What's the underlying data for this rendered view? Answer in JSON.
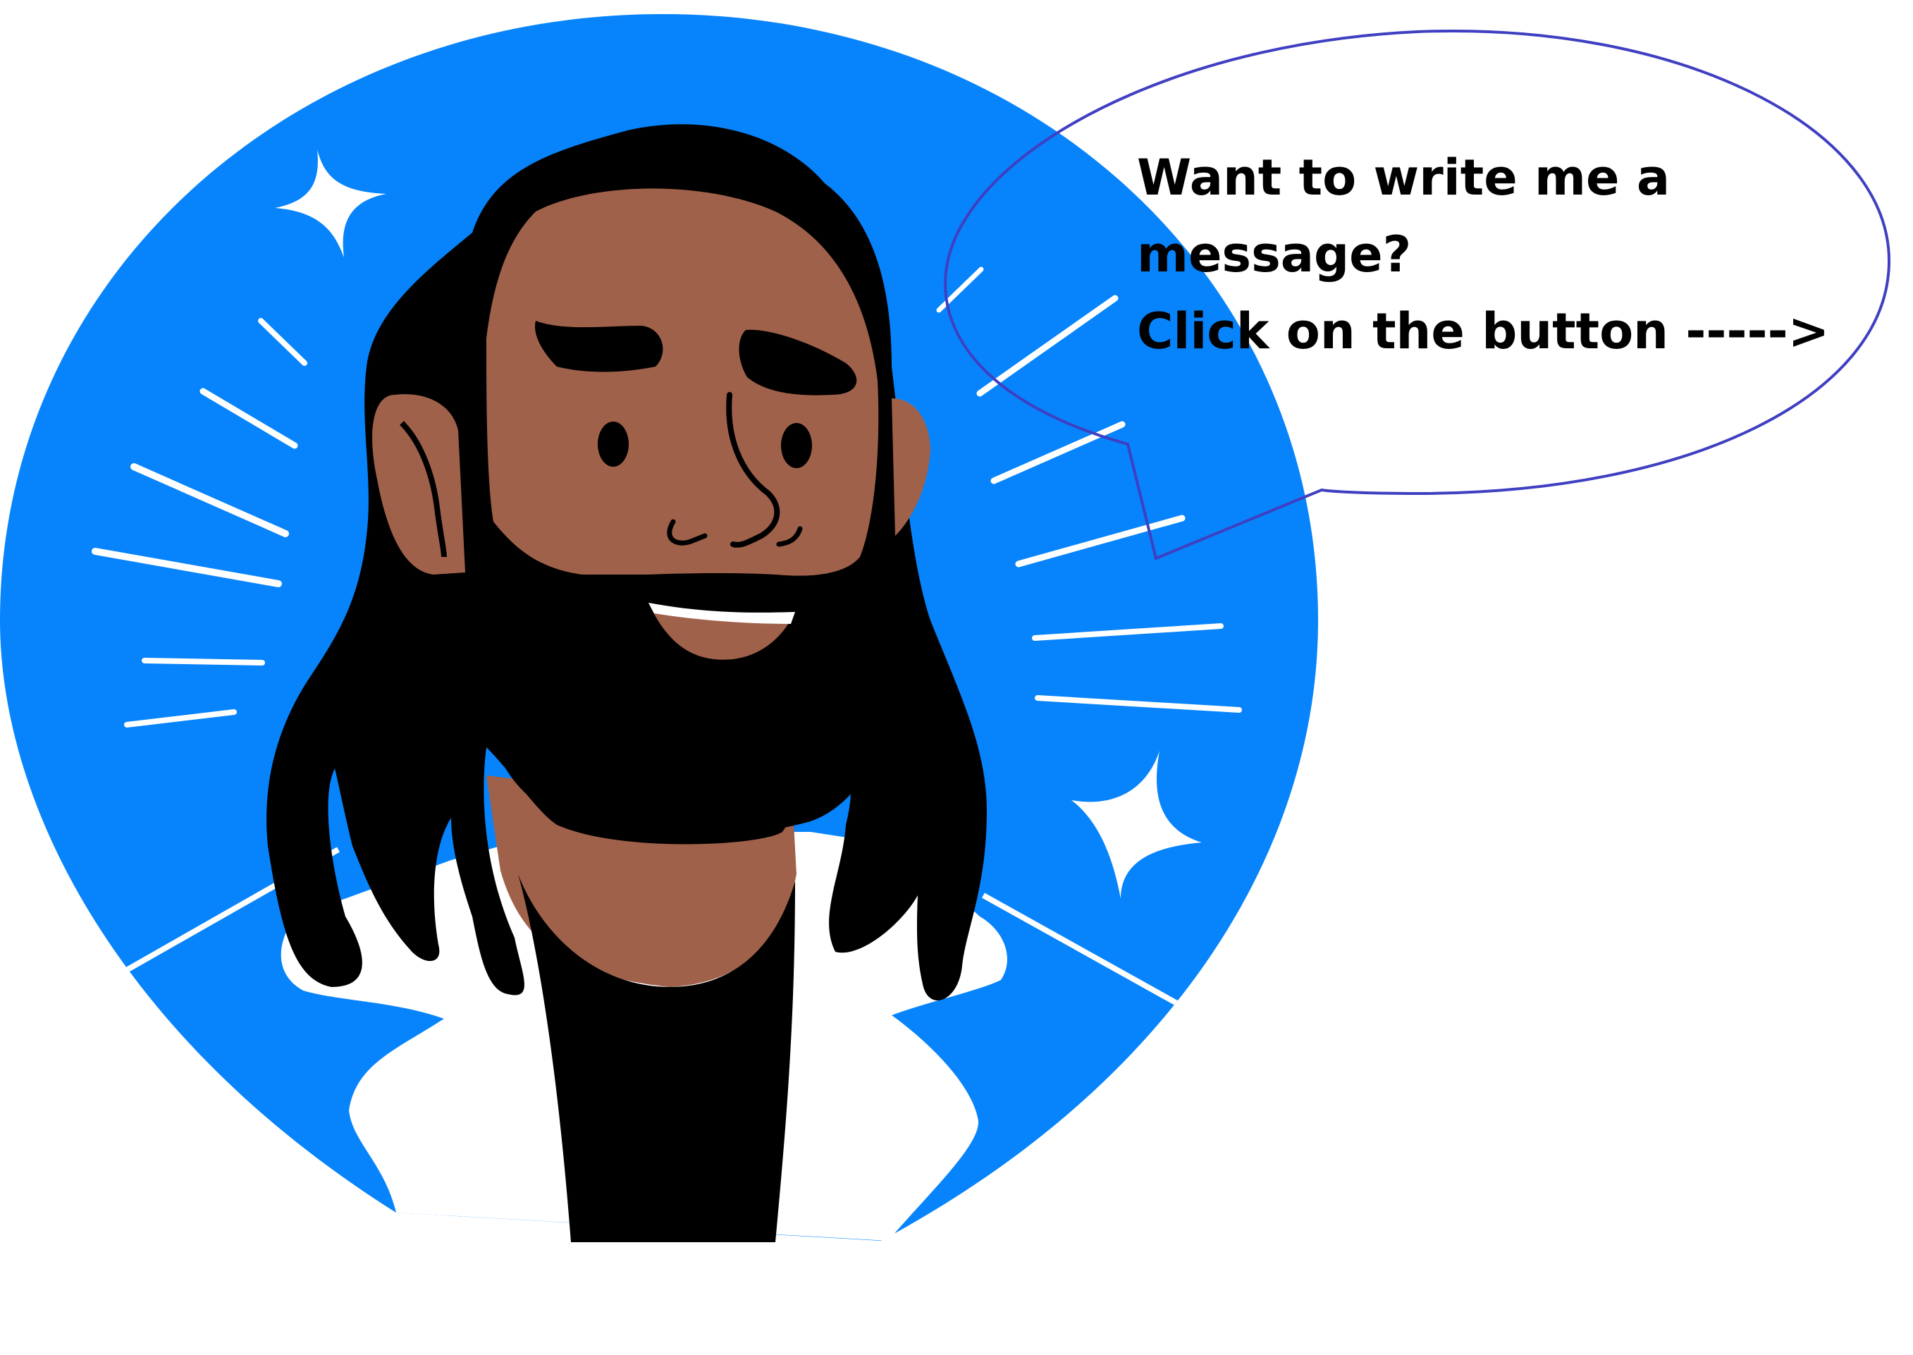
{
  "speech_bubble": {
    "lines": [
      "Want to write me a",
      "message?",
      "Click on the button ----->"
    ]
  },
  "illustration": {
    "subject": "bearded man with long black hair smiling",
    "colors": {
      "background_circle": "#0784FB",
      "skin": "#A0614A",
      "hair": "#000000",
      "shirt": "#FFFFFF",
      "bubble_outline": "#3F3FC2",
      "sparkle": "#FFFFFF"
    }
  }
}
